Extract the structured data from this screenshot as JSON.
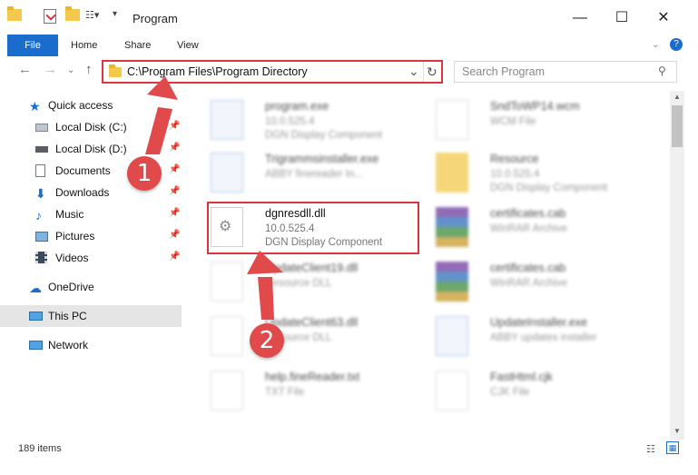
{
  "window": {
    "title": "Program",
    "minimize": "—",
    "maximize": "☐",
    "close": "✕"
  },
  "ribbon": {
    "tabs": [
      "File",
      "Home",
      "Share",
      "View"
    ]
  },
  "address": {
    "path": "C:\\Program Files\\Program Directory",
    "refresh": "↻",
    "dropdown": "⌄"
  },
  "search": {
    "placeholder": "Search Program"
  },
  "sidebar": {
    "items": [
      {
        "label": "Quick access"
      },
      {
        "label": "Local Disk (C:)"
      },
      {
        "label": "Local Disk (D:)"
      },
      {
        "label": "Documents"
      },
      {
        "label": "Downloads"
      },
      {
        "label": "Music"
      },
      {
        "label": "Pictures"
      },
      {
        "label": "Videos"
      },
      {
        "label": "OneDrive"
      },
      {
        "label": "This PC"
      },
      {
        "label": "Network"
      }
    ]
  },
  "files": [
    {
      "name": "program.exe",
      "l1": "10.0.525.4",
      "l2": "DGN Display Component"
    },
    {
      "name": "SndToWP14.wcm",
      "l1": "WCM File",
      "l2": ""
    },
    {
      "name": "Trigrammsinstaller.exe",
      "l1": "ABBY finereader In...",
      "l2": ""
    },
    {
      "name": "Resource",
      "l1": "10.0.525.4",
      "l2": "DGN Display Component"
    },
    {
      "name": "dgnresdll.dll",
      "l1": "10.0.525.4",
      "l2": "DGN Display Component"
    },
    {
      "name": "certificates.cab",
      "l1": "WinRAR Archive",
      "l2": ""
    },
    {
      "name": "UpdateClient19.dll",
      "l1": "Resource DLL",
      "l2": ""
    },
    {
      "name": "certificates.cab",
      "l1": "WinRAR Archive",
      "l2": ""
    },
    {
      "name": "UpdateClient63.dll",
      "l1": "Resource DLL",
      "l2": ""
    },
    {
      "name": "UpdateInstaller.exe",
      "l1": "ABBY updates installer",
      "l2": ""
    },
    {
      "name": "help.fineReader.txt",
      "l1": "TXT File",
      "l2": ""
    },
    {
      "name": "FastHtml.cjk",
      "l1": "CJK File",
      "l2": ""
    }
  ],
  "status": {
    "items": "189 items"
  },
  "annotations": {
    "step1": "1",
    "step2": "2"
  },
  "colors": {
    "accent": "#1a6dcc",
    "highlight": "#d9363e"
  }
}
